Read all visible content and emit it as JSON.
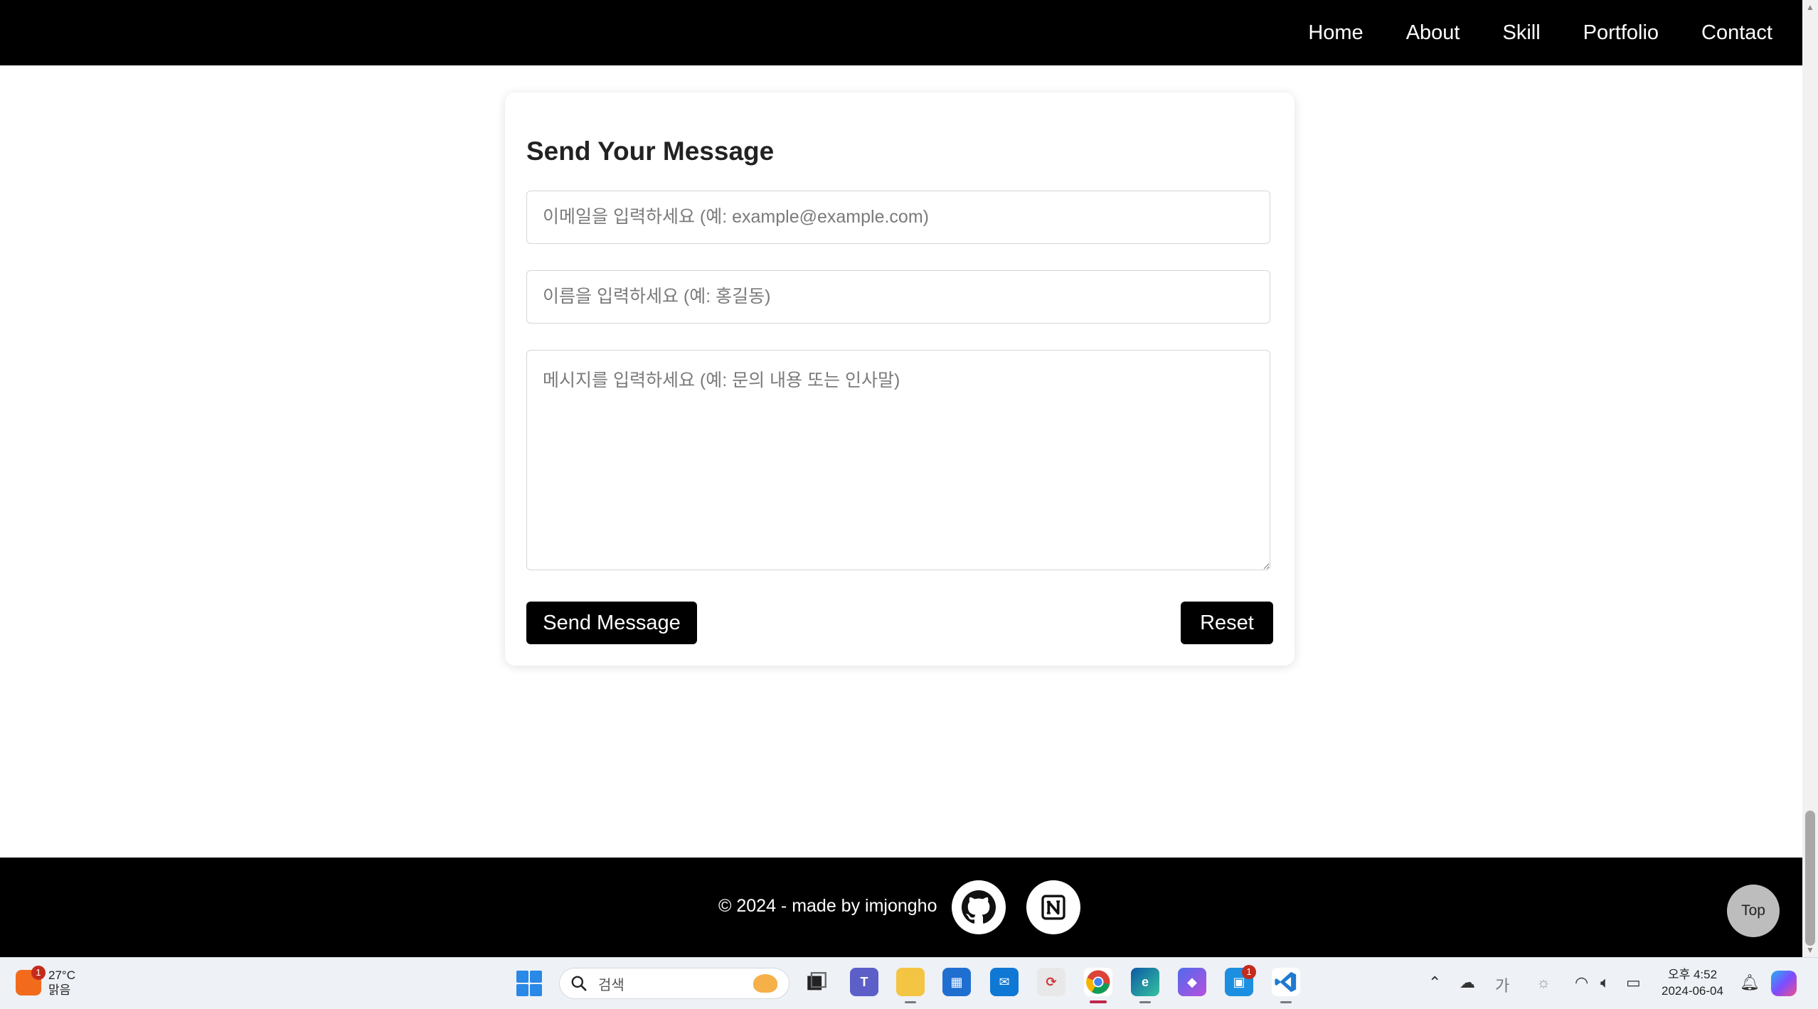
{
  "nav": {
    "items": [
      "Home",
      "About",
      "Skill",
      "Portfolio",
      "Contact"
    ]
  },
  "contact": {
    "title": "Send Your Message",
    "email_placeholder": "이메일을 입력하세요 (예: example@example.com)",
    "name_placeholder": "이름을 입력하세요 (예: 홍길동)",
    "message_placeholder": "메시지를 입력하세요 (예: 문의 내용 또는 인사말)",
    "send_label": "Send Message",
    "reset_label": "Reset"
  },
  "footer": {
    "copyright": "© 2024 - made by imjongho",
    "top_label": "Top",
    "icons": [
      "github-icon",
      "notion-icon"
    ]
  },
  "taskbar": {
    "weather_temp": "27°C",
    "weather_desc": "맑음",
    "weather_badge": "1",
    "search_label": "검색",
    "teams_badge": "1",
    "clock_time": "오후 4:52",
    "clock_date": "2024-06-04",
    "ime_label": "가"
  },
  "colors": {
    "nav_bg": "#000000",
    "button_bg": "#000000",
    "footer_bg": "#000000",
    "top_button_bg": "#bdbdbd"
  }
}
